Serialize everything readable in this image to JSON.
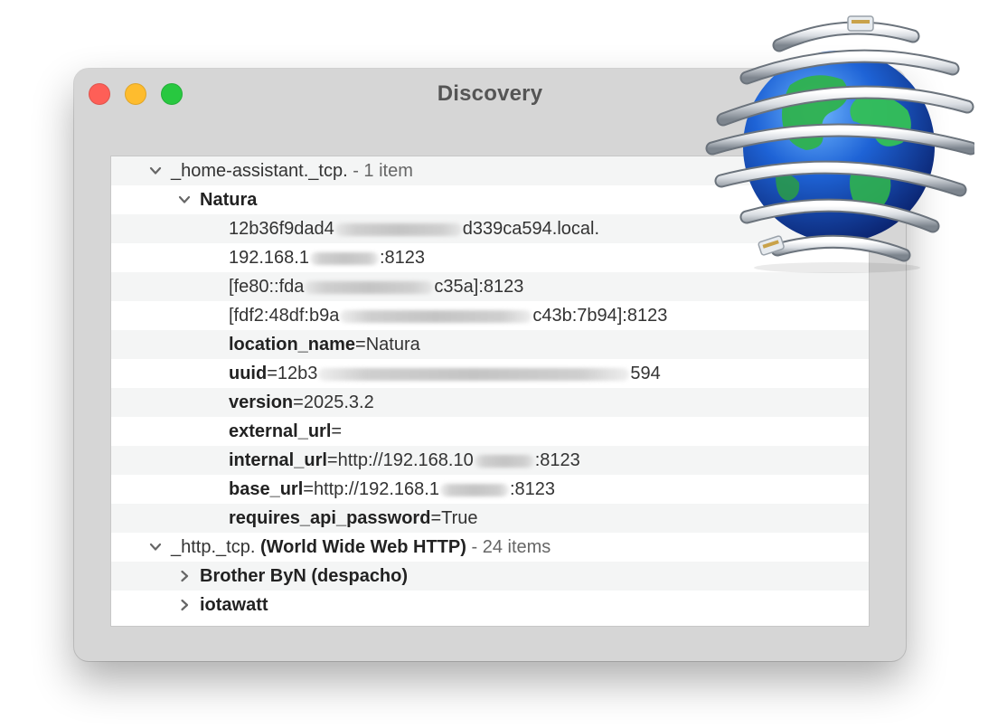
{
  "window": {
    "title": "Discovery"
  },
  "rows": [
    {
      "service": "_home-assistant._tcp.",
      "count": "- 1 item"
    },
    {
      "name": "Natura"
    },
    {
      "pre": "12b36f9dad4",
      "post": "d339ca594.local."
    },
    {
      "pre": "192.168.1",
      "post": ":8123"
    },
    {
      "pre": "[fe80::fda",
      "post": "c35a]:8123"
    },
    {
      "pre": "[fdf2:48df:b9a",
      "post": "c43b:7b94]:8123"
    },
    {
      "key": "location_name",
      "val": "=Natura"
    },
    {
      "key": "uuid",
      "val": "=12b3",
      "post": "594"
    },
    {
      "key": "version",
      "val": "=2025.3.2"
    },
    {
      "key": "external_url",
      "val": "="
    },
    {
      "key": "internal_url",
      "val": "=http://192.168.10",
      "post": ":8123"
    },
    {
      "key": "base_url",
      "val": "=http://192.168.1",
      "post": ":8123"
    },
    {
      "key": "requires_api_password",
      "val": "=True"
    },
    {
      "service": "_http._tcp.",
      "desc": "(World Wide Web HTTP)",
      "count": "- 24 items"
    },
    {
      "name": "Brother ByN (despacho)"
    },
    {
      "name": "iotawatt"
    }
  ],
  "colors": {
    "close": "#fe5f57",
    "minimize": "#febc2e",
    "zoom": "#28c840",
    "row_alt": "#f4f5f5"
  },
  "icons": {
    "app": "globe-ethernet-cable-icon",
    "expanded": "chevron-down-icon",
    "collapsed": "chevron-right-icon"
  }
}
